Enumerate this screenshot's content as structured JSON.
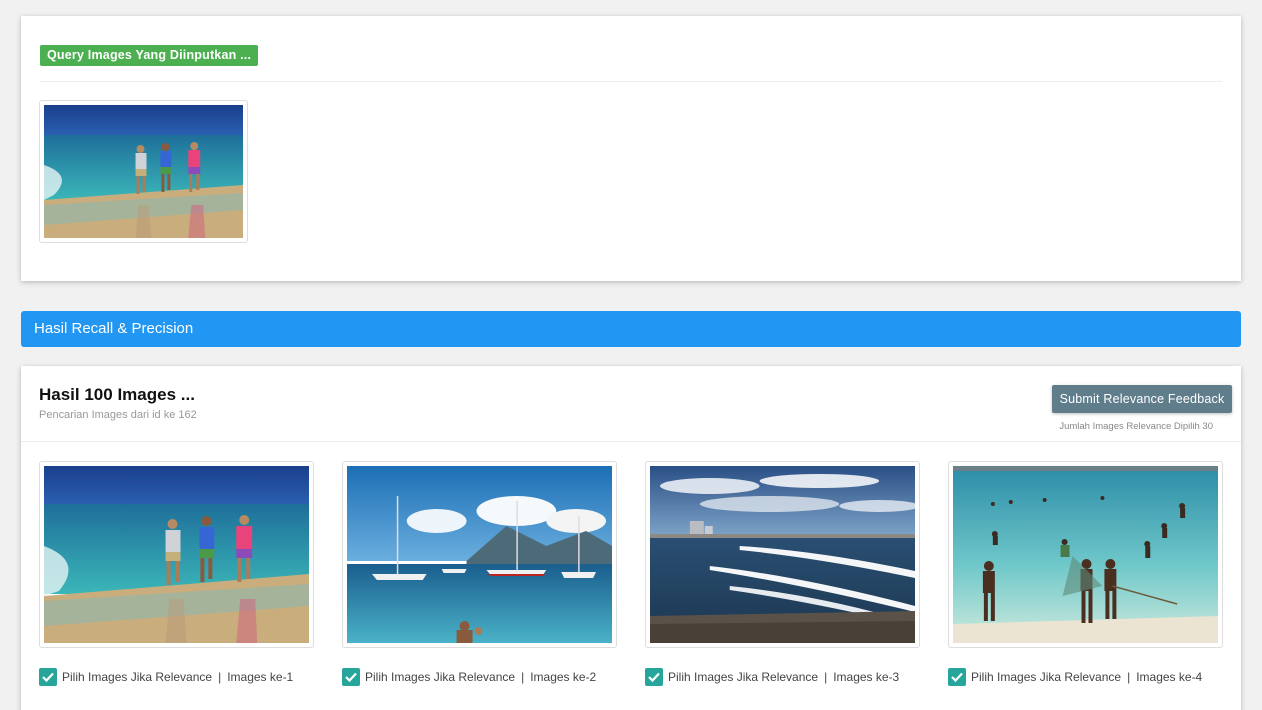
{
  "query_section": {
    "label": "Query Images Yang Diinputkan ...",
    "image_icon": "beach-runners-photo"
  },
  "recall_bar": {
    "label": "Hasil Recall & Precision",
    "color": "#2196f3"
  },
  "results": {
    "title": "Hasil 100 Images ...",
    "subtitle": "Pencarian Images dari id ke 162",
    "submit_label": "Submit Relevance Feedback",
    "selected_count": "Jumlah Images Relevance Dipilih 30",
    "items": [
      {
        "check_label": "Pilih Images Jika Relevance",
        "separator": "|",
        "index_label": "Images ke-1",
        "checked": true,
        "image_icon": "beach-runners-photo"
      },
      {
        "check_label": "Pilih Images Jika Relevance",
        "separator": "|",
        "index_label": "Images ke-2",
        "checked": true,
        "image_icon": "sailboats-harbor-photo"
      },
      {
        "check_label": "Pilih Images Jika Relevance",
        "separator": "|",
        "index_label": "Images ke-3",
        "checked": true,
        "image_icon": "coastal-waves-photo"
      },
      {
        "check_label": "Pilih Images Jika Relevance",
        "separator": "|",
        "index_label": "Images ke-4",
        "checked": true,
        "image_icon": "fishermen-shallow-water-photo"
      }
    ]
  },
  "colors": {
    "query_label_bg": "#4caf50",
    "submit_bg": "#607d8b",
    "checkbox_bg": "#26a69a"
  }
}
